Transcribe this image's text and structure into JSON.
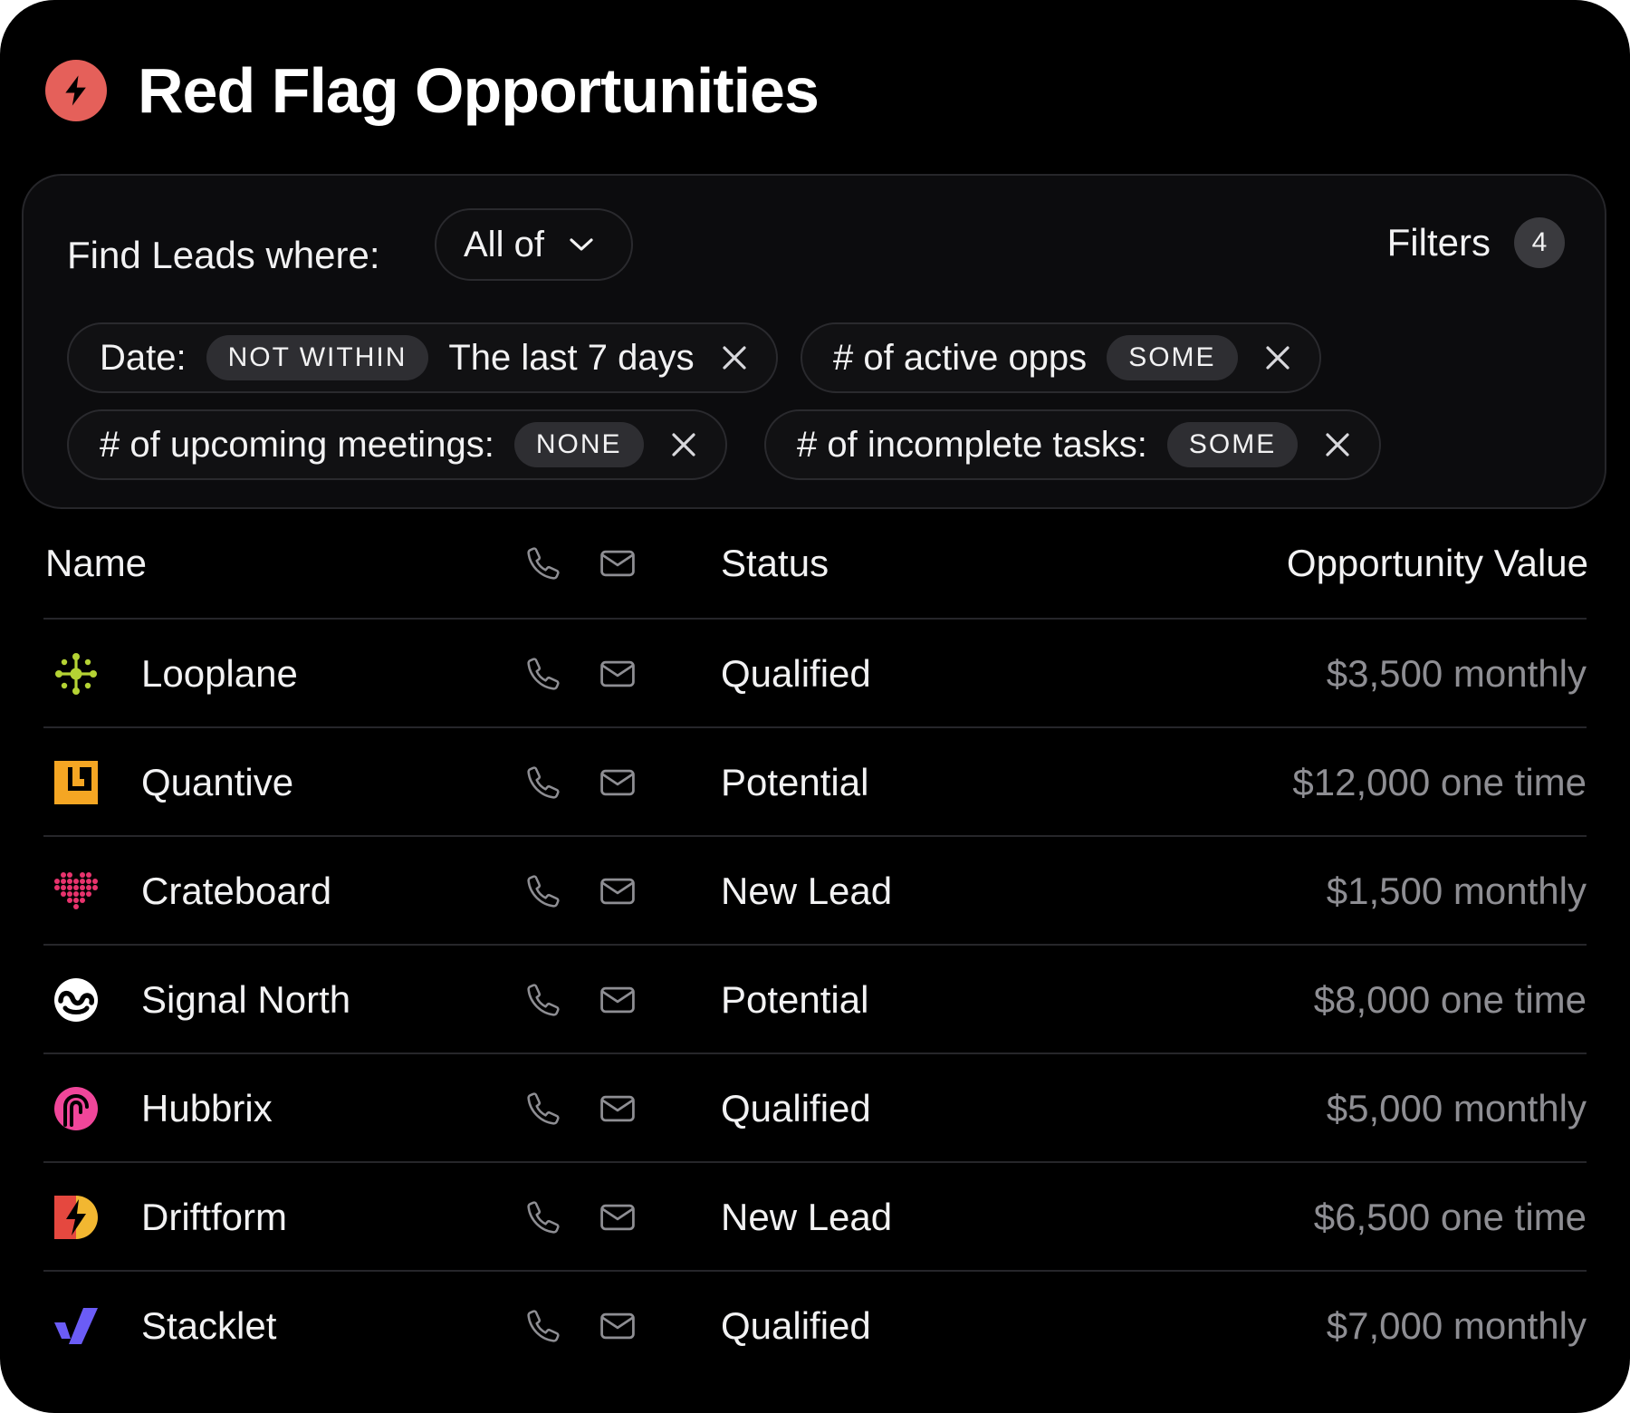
{
  "page": {
    "title": "Red Flag Opportunities",
    "accent_color": "#e5605a",
    "icon": "lightning-bolt-icon"
  },
  "filters": {
    "label": "Find Leads where:",
    "match_value": "All of",
    "filters_label": "Filters",
    "filters_count": "4",
    "chips": [
      {
        "label": "Date:",
        "badge": "NOT WITHIN",
        "value": "The last 7 days"
      },
      {
        "label": "# of active opps",
        "badge": "SOME"
      },
      {
        "label": "# of upcoming meetings:",
        "badge": "NONE"
      },
      {
        "label": "# of incomplete tasks:",
        "badge": "SOME"
      }
    ]
  },
  "table": {
    "columns": {
      "name": "Name",
      "phone_icon": "phone-icon",
      "mail_icon": "mail-icon",
      "status": "Status",
      "value": "Opportunity Value"
    },
    "rows": [
      {
        "name": "Looplane",
        "status": "Qualified",
        "value": "$3,500 monthly",
        "logo": "looplane-logo",
        "logo_color": "#b5d334"
      },
      {
        "name": "Quantive",
        "status": "Potential",
        "value": "$12,000 one time",
        "logo": "quantive-logo",
        "logo_color": "#f5a623"
      },
      {
        "name": "Crateboard",
        "status": "New Lead",
        "value": "$1,500 monthly",
        "logo": "crateboard-logo",
        "logo_color": "#e8336d"
      },
      {
        "name": "Signal North",
        "status": "Potential",
        "value": "$8,000 one time",
        "logo": "signal-north-logo",
        "logo_color": "#ffffff"
      },
      {
        "name": "Hubbrix",
        "status": "Qualified",
        "value": "$5,000 monthly",
        "logo": "hubbrix-logo",
        "logo_color": "#f0469a"
      },
      {
        "name": "Driftform",
        "status": "New Lead",
        "value": "$6,500 one time",
        "logo": "driftform-logo",
        "logo_color": "#e5483f"
      },
      {
        "name": "Stacklet",
        "status": "Qualified",
        "value": "$7,000 monthly",
        "logo": "stacklet-logo",
        "logo_color": "#6b5cf6"
      }
    ]
  }
}
